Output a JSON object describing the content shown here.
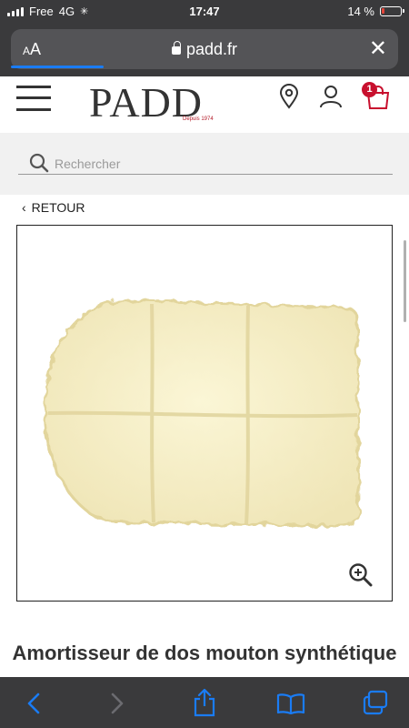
{
  "status": {
    "carrier": "Free",
    "network": "4G",
    "time": "17:47",
    "battery_pct": "14 %",
    "battery_level": 0.14
  },
  "browser": {
    "text_size_label": "AA",
    "url": "padd.fr",
    "close_icon": "close-icon",
    "load_progress": 0.24
  },
  "header": {
    "logo": "PADD",
    "logo_sub": "Depuis 1974",
    "cart_count": "1",
    "icons": [
      "menu-icon",
      "location-pin-icon",
      "user-icon",
      "shopping-bag-icon"
    ]
  },
  "search": {
    "placeholder": "Rechercher",
    "icon": "search-icon"
  },
  "nav": {
    "back_label": "RETOUR"
  },
  "product": {
    "title": "Amortisseur de dos mouton synthétique",
    "zoom_icon": "zoom-in-icon",
    "colors": {
      "fleece": "#f7f0c8",
      "fleece_shadow": "#e6dba6"
    }
  },
  "toolbar": {
    "icons": [
      "back-icon",
      "forward-icon",
      "share-icon",
      "bookmarks-icon",
      "tabs-icon"
    ]
  },
  "colors": {
    "accent": "#c8102e",
    "safari_blue": "#1a7cf5",
    "chrome_dark": "#3a3a3c"
  }
}
